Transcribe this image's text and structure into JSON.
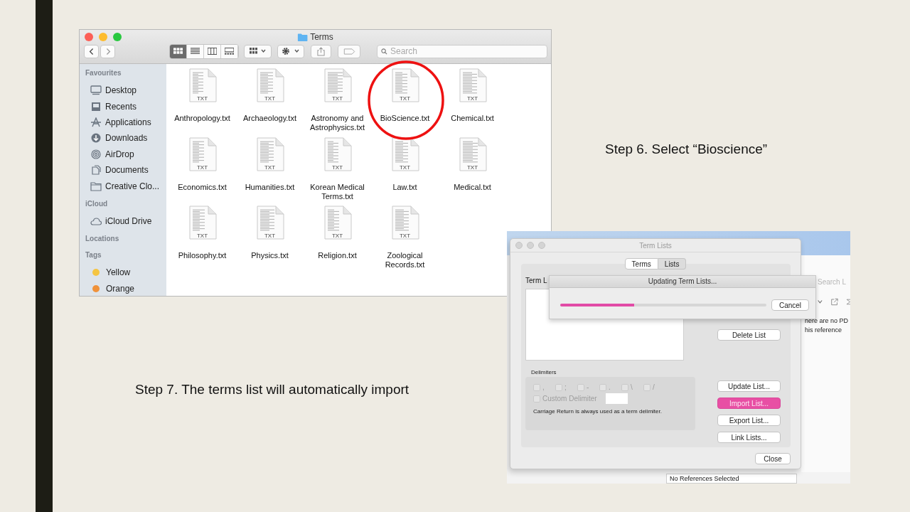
{
  "captions": [
    {
      "text": "Step 6. Select “Bioscience”"
    },
    {
      "text": "Step 7. The terms list  will automatically import"
    }
  ],
  "finder": {
    "title": "Terms",
    "search": {
      "placeholder": "Search"
    },
    "view_modes": [
      {
        "kind": "icons",
        "selected": true
      },
      {
        "kind": "list",
        "selected": false
      },
      {
        "kind": "columns",
        "selected": false
      },
      {
        "kind": "gallery",
        "selected": false
      }
    ],
    "sidebar": [
      {
        "heading": "Favourites",
        "items": [
          {
            "label": "Desktop",
            "kind": "desktop"
          },
          {
            "label": "Recents",
            "kind": "recents"
          },
          {
            "label": "Applications",
            "kind": "apps"
          },
          {
            "label": "Downloads",
            "kind": "downloads"
          },
          {
            "label": "AirDrop",
            "kind": "airdrop"
          },
          {
            "label": "Documents",
            "kind": "documents"
          },
          {
            "label": "Creative Clo...",
            "kind": "folder"
          }
        ]
      },
      {
        "heading": "iCloud",
        "items": [
          {
            "label": "iCloud Drive",
            "kind": "cloud"
          }
        ]
      },
      {
        "heading": "Locations"
      },
      {
        "heading": "Tags",
        "items": [
          {
            "label": "Yellow",
            "kind": "tag",
            "color": "#f5c542"
          },
          {
            "label": "Orange",
            "kind": "tag",
            "color": "#f0923a"
          }
        ]
      }
    ],
    "files": [
      {
        "name": "Anthropology.txt",
        "type": "TXT",
        "circled": false
      },
      {
        "name": "Archaeology.txt",
        "type": "TXT",
        "circled": false
      },
      {
        "name": "Astronomy and Astrophysics.txt",
        "type": "TXT",
        "circled": false
      },
      {
        "name": "BioScience.txt",
        "type": "TXT",
        "circled": true
      },
      {
        "name": "Chemical.txt",
        "type": "TXT",
        "circled": false
      },
      {
        "name": "Economics.txt",
        "type": "TXT",
        "circled": false
      },
      {
        "name": "Humanities.txt",
        "type": "TXT",
        "circled": false
      },
      {
        "name": "Korean Medical Terms.txt",
        "type": "TXT",
        "circled": false
      },
      {
        "name": "Law.txt",
        "type": "TXT",
        "circled": false
      },
      {
        "name": "Medical.txt",
        "type": "TXT",
        "circled": false
      },
      {
        "name": "Philosophy.txt",
        "type": "TXT",
        "circled": false
      },
      {
        "name": "Physics.txt",
        "type": "TXT",
        "circled": false
      },
      {
        "name": "Religion.txt",
        "type": "TXT",
        "circled": false
      },
      {
        "name": "Zoological Records.txt",
        "type": "TXT",
        "circled": false
      }
    ]
  },
  "background_app": {
    "search": {
      "placeholder": "Search L"
    },
    "message": [
      "here are no PD",
      "his reference"
    ],
    "status": "No References Selected"
  },
  "term_lists": {
    "title": "Term Lists",
    "tabs": [
      {
        "label": "Terms",
        "selected": false
      },
      {
        "label": "Lists",
        "selected": true
      }
    ],
    "list_label": "Term L",
    "side_buttons": [
      {
        "label": "Delete List",
        "default": false
      }
    ],
    "delimiters_label": "Delimiters",
    "delimiters": [
      {
        "label": ",",
        "checked": false,
        "disabled": true
      },
      {
        "label": ";",
        "checked": false,
        "disabled": true
      },
      {
        "label": "-",
        "checked": false,
        "disabled": true
      },
      {
        "label": ".",
        "checked": false,
        "disabled": true
      },
      {
        "label": "\\",
        "checked": false,
        "disabled": true
      },
      {
        "label": "/",
        "checked": false,
        "disabled": true
      }
    ],
    "custom_delimiter": {
      "label": "Custom Delimiter",
      "checked": false,
      "disabled": true
    },
    "note": "Carriage Return is always used as a term delimiter.",
    "buttons": [
      {
        "label": "Update List...",
        "default": false
      },
      {
        "label": "Import List...",
        "default": true
      },
      {
        "label": "Export List...",
        "default": false
      },
      {
        "label": "Link Lists...",
        "default": false
      }
    ],
    "close": "Close",
    "progress": {
      "title": "Updating Term Lists...",
      "level": 0.36,
      "cancel": "Cancel"
    }
  }
}
